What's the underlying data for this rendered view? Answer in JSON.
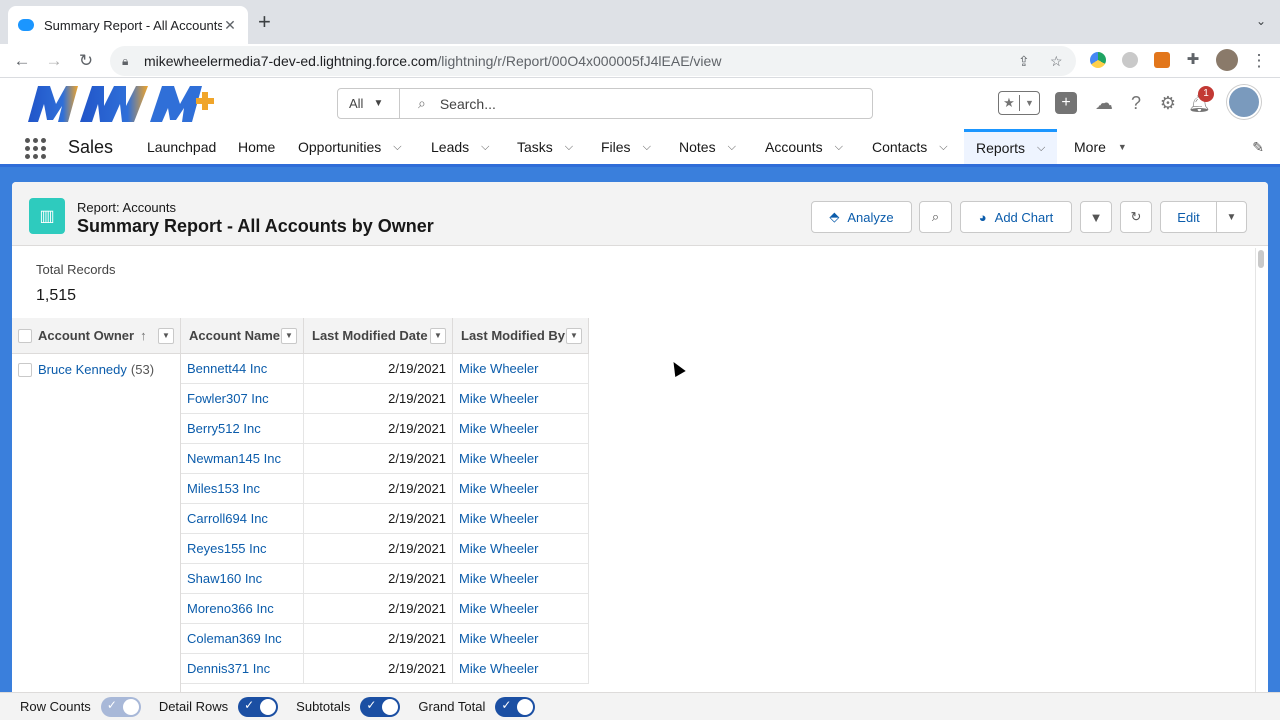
{
  "browser": {
    "tab_title": "Summary Report - All Accounts",
    "url_host": "mikewheelermedia7-dev-ed.lightning.force.com",
    "url_path": "/lightning/r/Report/00O4x000005fJ4lEAE/view"
  },
  "header": {
    "search_scope": "All",
    "search_placeholder": "Search...",
    "notification_count": "1"
  },
  "appnav": {
    "app_name": "Sales",
    "items": [
      {
        "label": "Launchpad",
        "chevron": false
      },
      {
        "label": "Home",
        "chevron": false
      },
      {
        "label": "Opportunities",
        "chevron": true
      },
      {
        "label": "Leads",
        "chevron": true
      },
      {
        "label": "Tasks",
        "chevron": true
      },
      {
        "label": "Files",
        "chevron": true
      },
      {
        "label": "Notes",
        "chevron": true
      },
      {
        "label": "Accounts",
        "chevron": true
      },
      {
        "label": "Contacts",
        "chevron": true
      },
      {
        "label": "Reports",
        "chevron": true,
        "active": true
      },
      {
        "label": "More",
        "chevron": true
      }
    ]
  },
  "report": {
    "type_label": "Report: Accounts",
    "title": "Summary Report - All Accounts by Owner",
    "buttons": {
      "analyze": "Analyze",
      "add_chart": "Add Chart",
      "edit": "Edit"
    },
    "total_records_label": "Total Records",
    "total_records_value": "1,515",
    "columns": [
      "Account Owner",
      "Account Name",
      "Last Modified Date",
      "Last Modified By"
    ],
    "group": {
      "owner": "Bruce Kennedy",
      "count": "(53)"
    },
    "rows": [
      {
        "name": "Bennett44 Inc",
        "date": "2/19/2021",
        "by": "Mike Wheeler"
      },
      {
        "name": "Fowler307 Inc",
        "date": "2/19/2021",
        "by": "Mike Wheeler"
      },
      {
        "name": "Berry512 Inc",
        "date": "2/19/2021",
        "by": "Mike Wheeler"
      },
      {
        "name": "Newman145 Inc",
        "date": "2/19/2021",
        "by": "Mike Wheeler"
      },
      {
        "name": "Miles153 Inc",
        "date": "2/19/2021",
        "by": "Mike Wheeler"
      },
      {
        "name": "Carroll694 Inc",
        "date": "2/19/2021",
        "by": "Mike Wheeler"
      },
      {
        "name": "Reyes155 Inc",
        "date": "2/19/2021",
        "by": "Mike Wheeler"
      },
      {
        "name": "Shaw160 Inc",
        "date": "2/19/2021",
        "by": "Mike Wheeler"
      },
      {
        "name": "Moreno366 Inc",
        "date": "2/19/2021",
        "by": "Mike Wheeler"
      },
      {
        "name": "Coleman369 Inc",
        "date": "2/19/2021",
        "by": "Mike Wheeler"
      },
      {
        "name": "Dennis371 Inc",
        "date": "2/19/2021",
        "by": "Mike Wheeler"
      }
    ]
  },
  "footer": {
    "row_counts": "Row Counts",
    "detail_rows": "Detail Rows",
    "subtotals": "Subtotals",
    "grand_total": "Grand Total"
  },
  "colors": {
    "brand_blue": "#0b5cab",
    "header_band": "#3a7fdc",
    "report_icon": "#2ecbbe"
  }
}
